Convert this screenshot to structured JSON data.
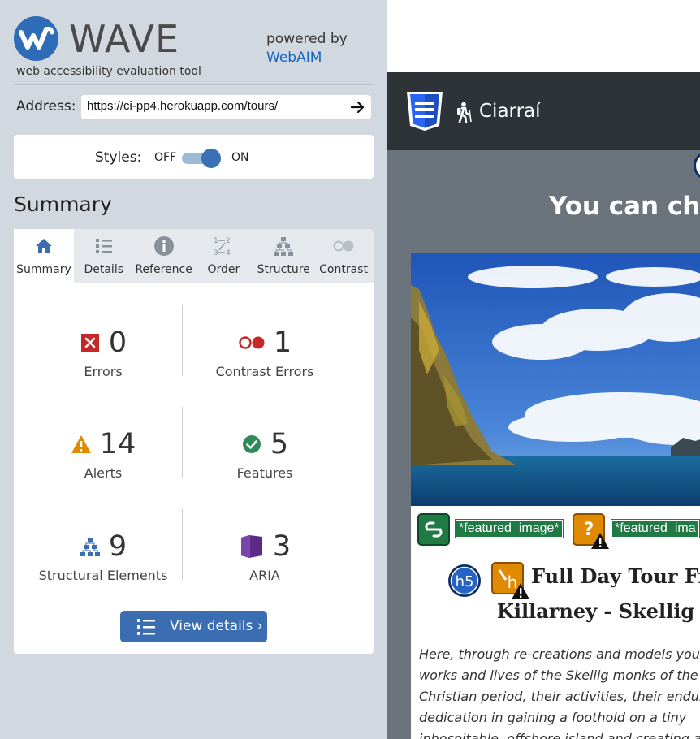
{
  "wave": {
    "logo_text": "WAVE",
    "tagline": "web accessibility evaluation tool",
    "powered_by": "powered by",
    "webaim_link": "WebAIM",
    "brand_color": "#2e6cb8"
  },
  "address": {
    "label": "Address:",
    "value": "https://ci-pp4.herokuapp.com/tours/"
  },
  "styles": {
    "label": "Styles:",
    "off": "OFF",
    "on": "ON",
    "state": "on"
  },
  "summary_title": "Summary",
  "tabs": [
    {
      "label": "Summary",
      "icon": "home-icon",
      "active": true
    },
    {
      "label": "Details",
      "icon": "list-icon"
    },
    {
      "label": "Reference",
      "icon": "info-icon"
    },
    {
      "label": "Order",
      "icon": "order-icon"
    },
    {
      "label": "Structure",
      "icon": "structure-icon"
    },
    {
      "label": "Contrast",
      "icon": "contrast-icon"
    }
  ],
  "stats": [
    {
      "value": "0",
      "label": "Errors",
      "icon": "error-icon",
      "color": "#c62828"
    },
    {
      "value": "1",
      "label": "Contrast Errors",
      "icon": "contrast-error-icon",
      "color": "#c62828"
    },
    {
      "value": "14",
      "label": "Alerts",
      "icon": "alert-icon",
      "color": "#e08a00"
    },
    {
      "value": "5",
      "label": "Features",
      "icon": "feature-icon",
      "color": "#2e8b57"
    },
    {
      "value": "9",
      "label": "Structural Elements",
      "icon": "structure-icon",
      "color": "#3a6db1"
    },
    {
      "value": "3",
      "label": "ARIA",
      "icon": "aria-icon",
      "color": "#5b2a86"
    }
  ],
  "view_details": "View details ›",
  "preview": {
    "brand": "Ciarraí",
    "heading": "You can cho",
    "tag_1": "*featured_image*",
    "tag_2": "*featured_ima",
    "tour_title_1": "Full Day Tour Fro",
    "tour_title_2": "Killarney - Skellig",
    "description": "Here, through re-creations and models you ca the works and lives of the Skellig monks of the Christian period, their activities, their enduran their dedication in gaining a foothold on a tiny inhospitable, offshore island and creating a"
  }
}
